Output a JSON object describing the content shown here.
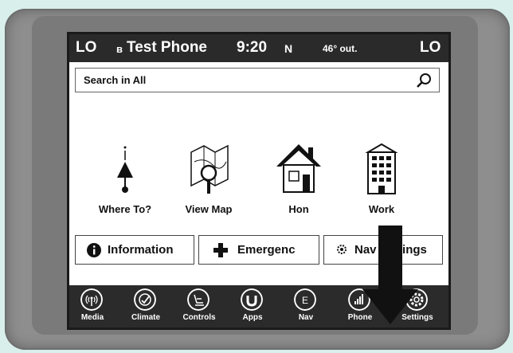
{
  "status": {
    "left_zone": "LO",
    "bluetooth_icon": "bluetooth-icon",
    "phone_name": "Test Phone",
    "time": "9:20",
    "heading": "N",
    "temperature": "46° out.",
    "right_zone": "LO"
  },
  "search": {
    "text": "Search in All",
    "icon": "search-icon"
  },
  "tiles": [
    {
      "label": "Where To?",
      "icon": "compass-arrow-icon"
    },
    {
      "label": "View Map",
      "icon": "map-magnifier-icon"
    },
    {
      "label": "Hon",
      "icon": "home-icon"
    },
    {
      "label": "Work",
      "icon": "building-icon"
    }
  ],
  "buttons": {
    "information": {
      "label": "Information",
      "icon": "info-icon"
    },
    "emergency": {
      "label": "Emergenc",
      "icon": "plus-icon"
    },
    "nav_settings": {
      "label": "Nav Settings",
      "icon": "gear-icon"
    }
  },
  "navbar": [
    {
      "label": "Media",
      "icon": "media-icon"
    },
    {
      "label": "Climate",
      "icon": "climate-icon"
    },
    {
      "label": "Controls",
      "icon": "controls-icon"
    },
    {
      "label": "Apps",
      "icon": "apps-icon"
    },
    {
      "label": "Nav",
      "icon": "nav-compass-icon"
    },
    {
      "label": "Phone",
      "icon": "phone-icon"
    },
    {
      "label": "Settings",
      "icon": "settings-icon"
    }
  ],
  "colors": {
    "background": "#d9efec",
    "bezel": "#8e8e8e",
    "screen_bar": "#2b2b2b",
    "content": "#ffffff"
  }
}
